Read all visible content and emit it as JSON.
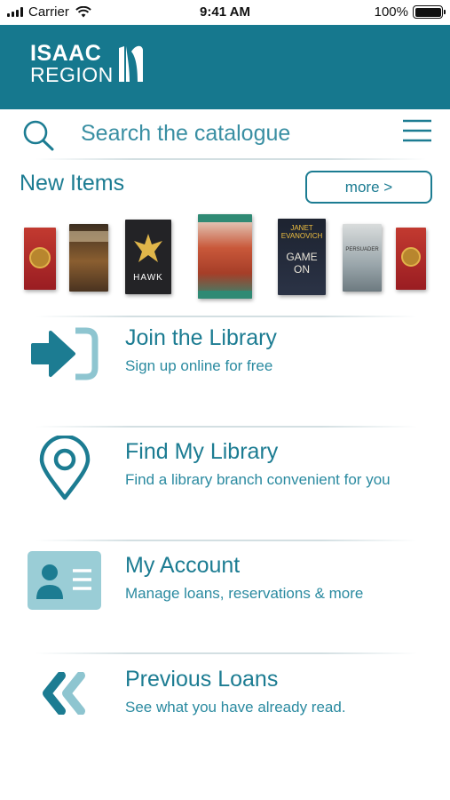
{
  "status_bar": {
    "carrier": "Carrier",
    "time": "9:41 AM",
    "battery": "100%"
  },
  "header": {
    "logo_line1": "ISAAC",
    "logo_line2": "REGION",
    "background": "#16788e"
  },
  "search": {
    "placeholder": "Search the catalogue"
  },
  "new_items": {
    "title": "New Items",
    "more_label": "more >",
    "books": [
      {
        "name": "book-cover-1",
        "color": "#b8242a"
      },
      {
        "name": "book-cover-2",
        "color": "#6a4a2a"
      },
      {
        "name": "book-cover-3",
        "color": "#2a2a2e"
      },
      {
        "name": "book-cover-4",
        "color": "#c24a2e"
      },
      {
        "name": "book-cover-5",
        "color": "#1e2430"
      },
      {
        "name": "book-cover-6",
        "color": "#9aa3a6"
      },
      {
        "name": "book-cover-7",
        "color": "#b02428"
      }
    ]
  },
  "menu": [
    {
      "title": "Join the Library",
      "subtitle": "Sign up online for free"
    },
    {
      "title": "Find My Library",
      "subtitle": "Find a library branch convenient for you"
    },
    {
      "title": "My Account",
      "subtitle": "Manage loans, reservations & more"
    },
    {
      "title": "Previous Loans",
      "subtitle": "See what you have already read."
    }
  ],
  "colors": {
    "accent": "#1c7c92",
    "icon_light": "#8ec5d0",
    "card_light": "#9acdd6"
  }
}
